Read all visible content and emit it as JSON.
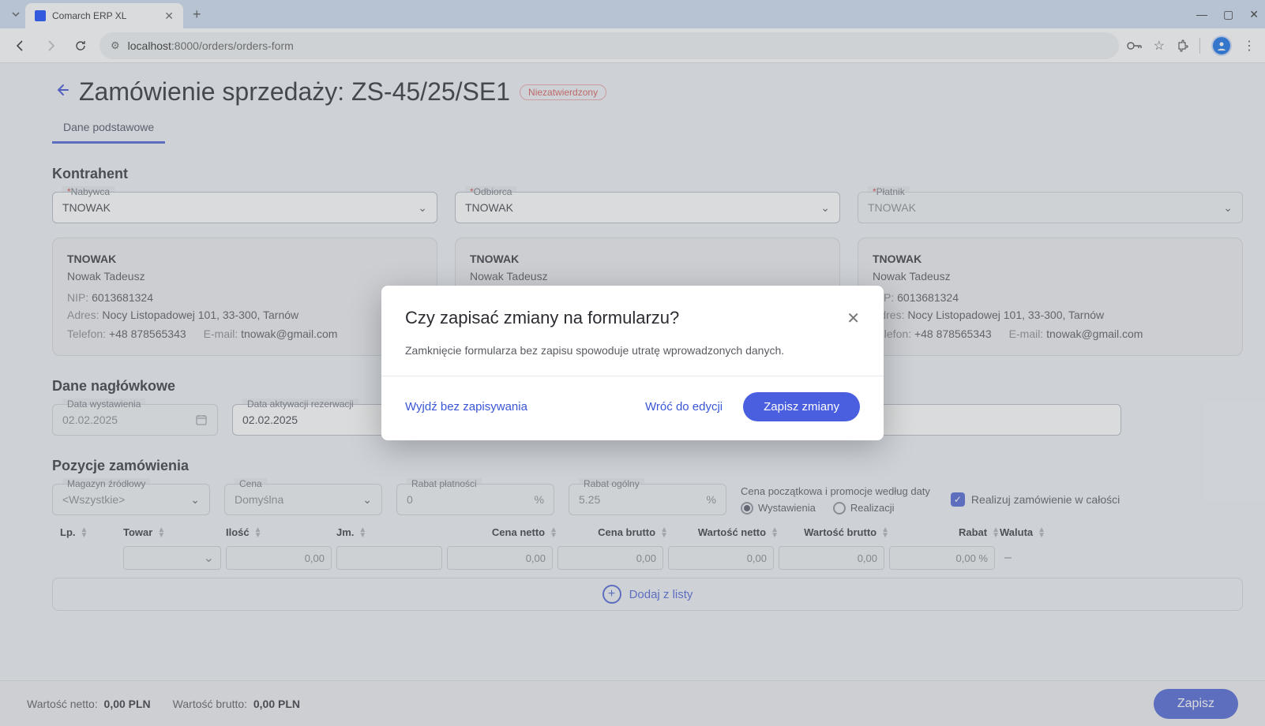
{
  "browser": {
    "tab_title": "Comarch ERP XL",
    "url_host": "localhost",
    "url_port_path": ":8000/orders/orders-form"
  },
  "page": {
    "title": "Zamówienie sprzedaży: ZS-45/25/SE1",
    "status_badge": "Niezatwierdzony",
    "tab_basic": "Dane podstawowe"
  },
  "kontrahent": {
    "heading": "Kontrahent",
    "nabywca_label": "Nabywca",
    "odbiorca_label": "Odbiorca",
    "platnik_label": "Płatnik",
    "value": "TNOWAK",
    "card": {
      "code": "TNOWAK",
      "name": "Nowak Tadeusz",
      "nip_label": "NIP:",
      "nip": "6013681324",
      "adres_label": "Adres:",
      "adres": "Nocy Listopadowej 101, 33-300, Tarnów",
      "tel_label": "Telefon:",
      "tel": "+48 878565343",
      "email_label": "E-mail:",
      "email": "tnowak@gmail.com"
    }
  },
  "naglowkowe": {
    "heading": "Dane nagłówkowe",
    "data_wyst_label": "Data wystawienia",
    "data_wyst": "02.02.2025",
    "data_akt_label": "Data aktywacji rezerwacji",
    "data_akt": "02.02.2025"
  },
  "pozycje": {
    "heading": "Pozycje zamówienia",
    "magazyn_label": "Magazyn źródłowy",
    "magazyn_val": "<Wszystkie>",
    "cena_label": "Cena",
    "cena_val": "Domyślna",
    "rabat_pl_label": "Rabat płatności",
    "rabat_pl_val": "0",
    "rabat_og_label": "Rabat ogólny",
    "rabat_og_val": "5.25",
    "pct": "%",
    "radio_header": "Cena początkowa i promocje według daty",
    "radio_wyst": "Wystawienia",
    "radio_real": "Realizacji",
    "realize_all": "Realizuj zamówienie w całości",
    "cols": {
      "lp": "Lp.",
      "towar": "Towar",
      "ilosc": "Ilość",
      "jm": "Jm.",
      "cnetto": "Cena netto",
      "cbrutto": "Cena brutto",
      "wnetto": "Wartość netto",
      "wbrutto": "Wartość brutto",
      "rabat": "Rabat",
      "waluta": "Waluta"
    },
    "row1": {
      "ilosc": "0,00",
      "cnetto": "0,00",
      "cbrutto": "0,00",
      "wnetto": "0,00",
      "wbrutto": "0,00",
      "rabat": "0,00 %",
      "waluta": "–"
    },
    "add_label": "Dodaj z listy"
  },
  "footer": {
    "wn_label": "Wartość netto:",
    "wn_val": "0,00 PLN",
    "wb_label": "Wartość brutto:",
    "wb_val": "0,00 PLN",
    "save": "Zapisz"
  },
  "modal": {
    "title": "Czy zapisać zmiany na formularzu?",
    "body": "Zamknięcie formularza bez zapisu spowoduje utratę wprowadzonych danych.",
    "exit": "Wyjdź bez zapisywania",
    "back": "Wróć do edycji",
    "save": "Zapisz zmiany"
  }
}
